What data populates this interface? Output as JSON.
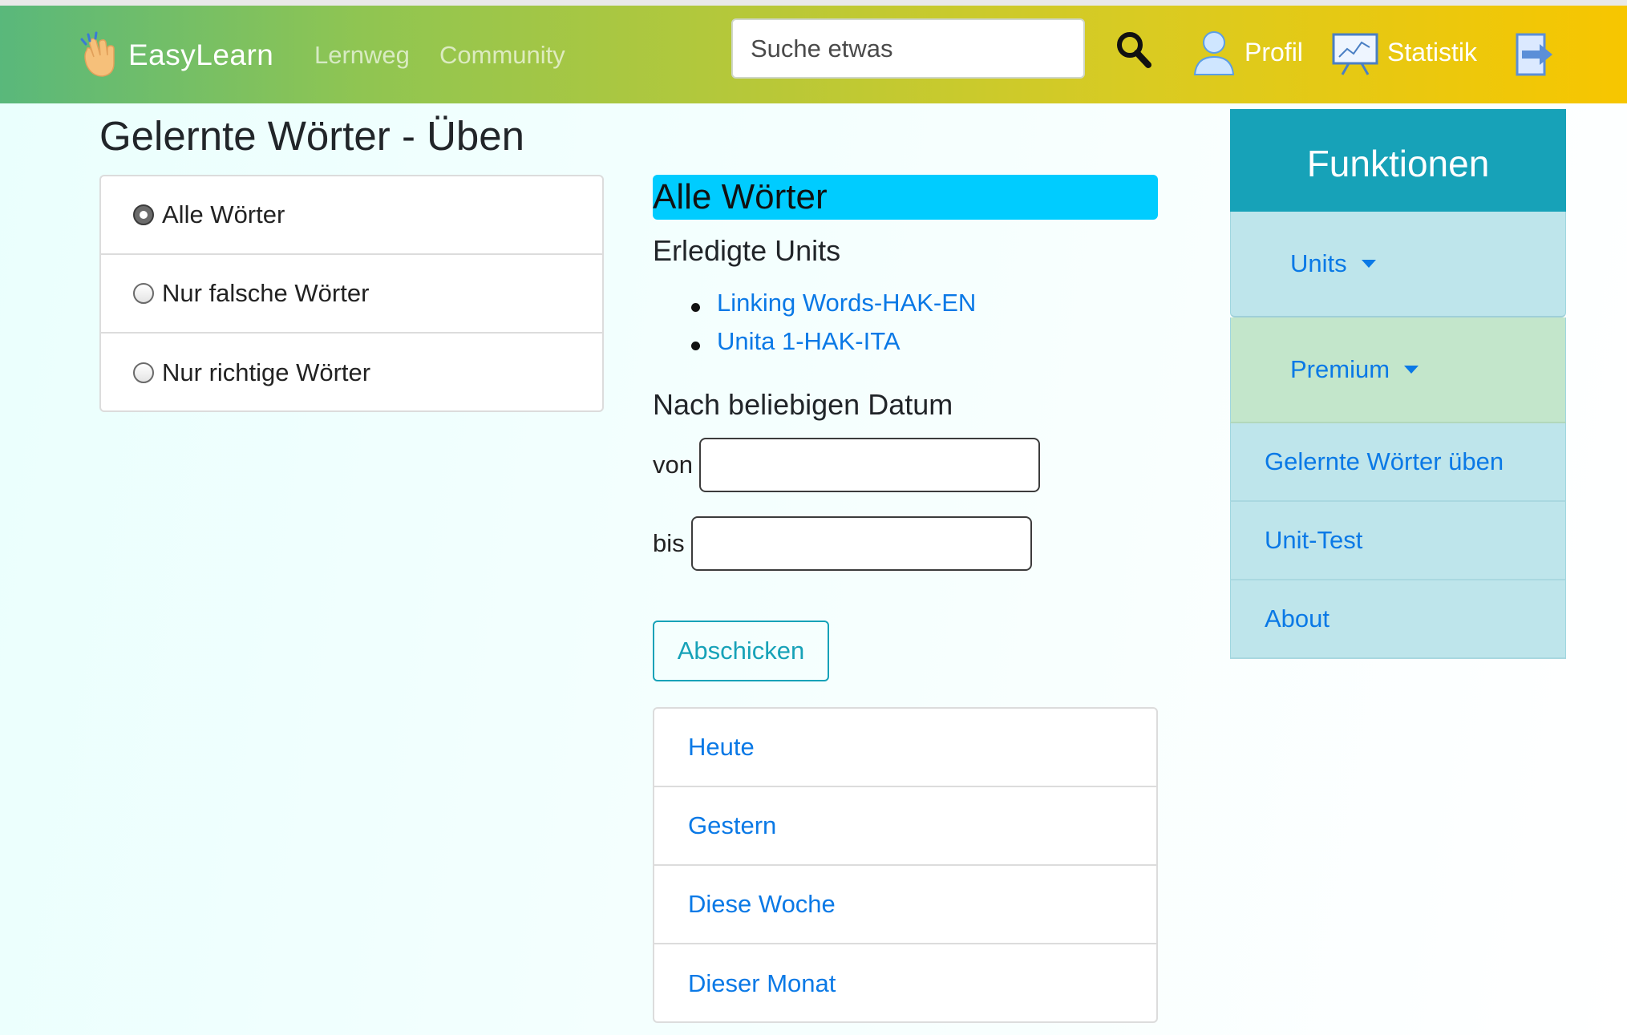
{
  "navbar": {
    "brand": "EasyLearn",
    "links": [
      "Lernweg",
      "Community"
    ],
    "search_placeholder": "Suche etwas",
    "profile_label": "Profil",
    "statistics_label": "Statistik"
  },
  "page": {
    "title": "Gelernte Wörter - Üben"
  },
  "filters": {
    "options": [
      "Alle Wörter",
      "Nur falsche Wörter",
      "Nur richtige Wörter"
    ],
    "selected": "Alle Wörter"
  },
  "main": {
    "heading": "Alle Wörter",
    "done_units_heading": "Erledigte Units",
    "units": [
      "Linking Words-HAK-EN",
      "Unita 1-HAK-ITA"
    ],
    "date_heading": "Nach beliebigen Datum",
    "from_label": "von",
    "to_label": "bis",
    "submit_label": "Abschicken",
    "periods": [
      "Heute",
      "Gestern",
      "Diese Woche",
      "Dieser Monat"
    ]
  },
  "sidebar": {
    "title": "Funktionen",
    "units_label": "Units",
    "premium_label": "Premium",
    "items": [
      "Gelernte Wörter üben",
      "Unit-Test",
      "About"
    ]
  },
  "colors": {
    "accent": "#17a2b8",
    "link": "#0a79e6",
    "highlight": "#00ccff",
    "units_bg": "#bee5eb",
    "premium_bg": "#c3e6cb"
  }
}
